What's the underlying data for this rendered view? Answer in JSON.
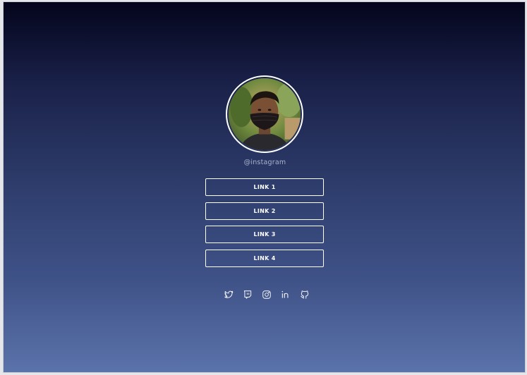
{
  "profile": {
    "handle": "@instagram",
    "avatar_alt": "profile photo"
  },
  "links": [
    {
      "label": "LINK 1"
    },
    {
      "label": "LINK 2"
    },
    {
      "label": "LINK 3"
    },
    {
      "label": "LINK 4"
    }
  ],
  "socials": [
    {
      "icon": "twitter-icon"
    },
    {
      "icon": "twitch-icon"
    },
    {
      "icon": "instagram-icon"
    },
    {
      "icon": "linkedin-icon"
    },
    {
      "icon": "github-icon"
    }
  ],
  "colors": {
    "gradient_top": "#04051c",
    "gradient_bottom": "#5a73aa",
    "button_border": "#ffffff",
    "handle_text": "#aab3cc"
  }
}
